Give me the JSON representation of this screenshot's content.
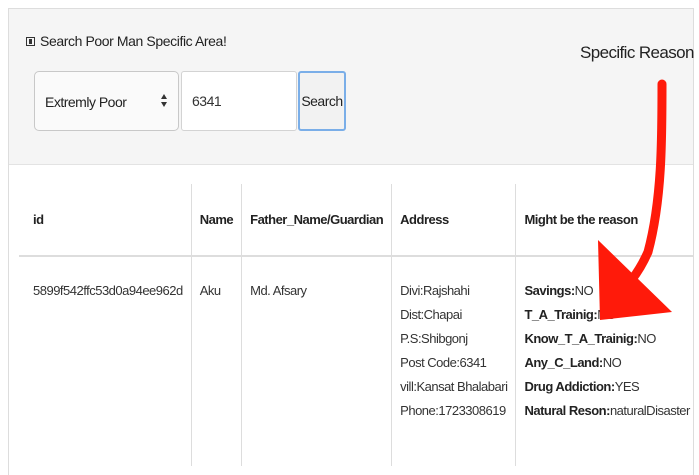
{
  "search_panel": {
    "title": "Search Poor Man Specific Area!",
    "icon": "document-icon",
    "category_select": {
      "selected": "Extremly Poor"
    },
    "post_code_input": {
      "value": "6341"
    },
    "search_button_label": "Search"
  },
  "annotation": {
    "label": "Specific Reason",
    "arrow_color": "#ff1a0a"
  },
  "table": {
    "headers": [
      "id",
      "Name",
      "Father_Name/Guardian",
      "Address",
      "Might be the reason"
    ],
    "rows": [
      {
        "id": "5899f542ffc53d0a94ee962d",
        "name": "Aku",
        "father_name": "Md. Afsary",
        "address": [
          "Divi:Rajshahi",
          "Dist:Chapai",
          "P.S:Shibgonj",
          "Post Code:6341",
          "vill:Kansat Bhalabari",
          "Phone:1723308619"
        ],
        "reasons": [
          {
            "key": "Savings:",
            "value": "NO"
          },
          {
            "key": "T_A_Trainig:",
            "value": "NO"
          },
          {
            "key": "Know_T_A_Trainig:",
            "value": "NO"
          },
          {
            "key": "Any_C_Land:",
            "value": "NO"
          },
          {
            "key": "Drug Addiction:",
            "value": "YES"
          },
          {
            "key": "Natural Reson:",
            "value": "naturalDisaster"
          }
        ]
      }
    ]
  }
}
